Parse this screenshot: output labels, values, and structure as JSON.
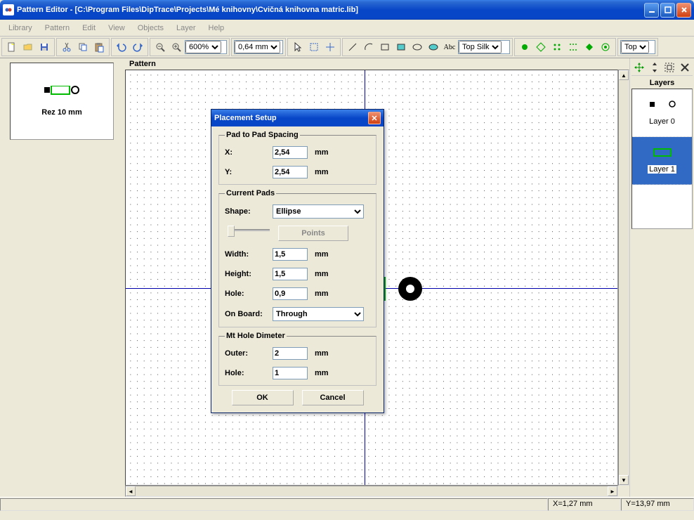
{
  "window": {
    "title": "Pattern Editor - [C:\\Program Files\\DipTrace\\Projects\\Mé knihovny\\Cvičná knihovna matric.lib]"
  },
  "menu": {
    "items": [
      "Library",
      "Pattern",
      "Edit",
      "View",
      "Objects",
      "Layer",
      "Help"
    ]
  },
  "toolbar": {
    "zoom": "600%",
    "grid": "0,64 mm",
    "abc": "Abc",
    "layer_sel": "Top Silk",
    "pos_sel": "Top"
  },
  "canvas": {
    "title": "Pattern"
  },
  "library": {
    "item_label": "Rez 10 mm"
  },
  "layers": {
    "title": "Layers",
    "items": [
      {
        "name": "Layer 0"
      },
      {
        "name": "Layer 1"
      }
    ]
  },
  "dialog": {
    "title": "Placement Setup",
    "group1": "Pad to Pad Spacing",
    "x_label": "X:",
    "x_val": "2,54",
    "unit": "mm",
    "y_label": "Y:",
    "y_val": "2,54",
    "group2": "Current Pads",
    "shape_label": "Shape:",
    "shape_val": "Ellipse",
    "points_btn": "Points",
    "width_label": "Width:",
    "width_val": "1,5",
    "height_label": "Height:",
    "height_val": "1,5",
    "hole_label": "Hole:",
    "hole_val": "0,9",
    "onboard_label": "On Board:",
    "onboard_val": "Through",
    "group3": "Mt Hole Dimeter",
    "outer_label": "Outer:",
    "outer_val": "2",
    "hole2_label": "Hole:",
    "hole2_val": "1",
    "ok": "OK",
    "cancel": "Cancel"
  },
  "status": {
    "x": "X=1,27 mm",
    "y": "Y=13,97 mm"
  }
}
